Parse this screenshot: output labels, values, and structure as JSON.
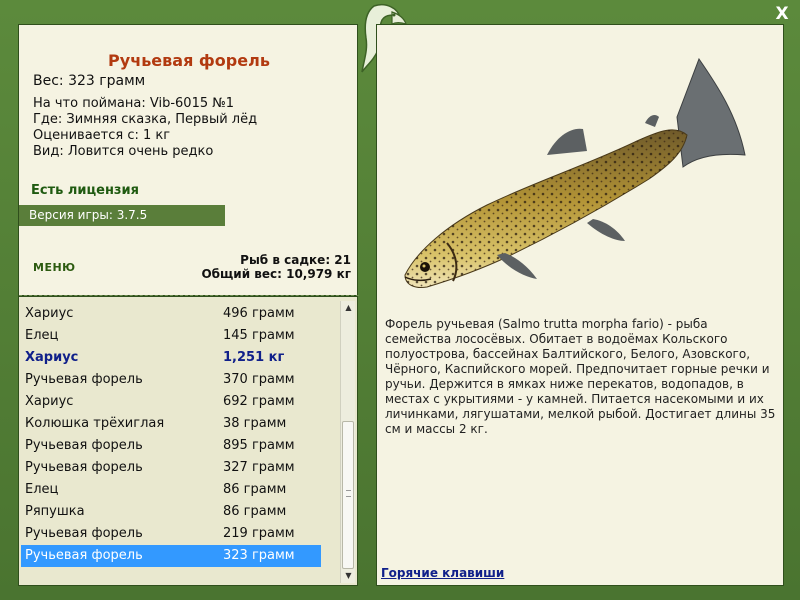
{
  "fish": {
    "title": "Ручьевая форель",
    "weight": "Вес: 323 грамм",
    "caught_with": "На что поймана: Vib-6015 №1",
    "location": "Где: Зимняя сказка, Первый лёд",
    "valued_from": "Оценивается с: 1 кг",
    "kind": "Вид: Ловится очень редко"
  },
  "license": "Есть лицензия",
  "version": "Версия игры: 3.7.5",
  "menu_label": "МЕНЮ",
  "stats": {
    "fish_in_keepnet": "Рыб в садке: 21",
    "total_weight": "Общий вес: 10,979 кг"
  },
  "catch_list": [
    {
      "name": "Хариус",
      "weight": "496 грамм",
      "style": "normal"
    },
    {
      "name": "Елец",
      "weight": "145 грамм",
      "style": "normal"
    },
    {
      "name": "Хариус",
      "weight": "1,251 кг",
      "style": "bold"
    },
    {
      "name": "Ручьевая форель",
      "weight": "370 грамм",
      "style": "normal"
    },
    {
      "name": "Хариус",
      "weight": "692 грамм",
      "style": "normal"
    },
    {
      "name": "Колюшка трёхиглая",
      "weight": "38 грамм",
      "style": "normal"
    },
    {
      "name": "Ручьевая форель",
      "weight": "895 грамм",
      "style": "normal"
    },
    {
      "name": "Ручьевая форель",
      "weight": "327 грамм",
      "style": "normal"
    },
    {
      "name": "Елец",
      "weight": "86 грамм",
      "style": "normal"
    },
    {
      "name": "Ряпушка",
      "weight": "86 грамм",
      "style": "normal"
    },
    {
      "name": "Ручьевая форель",
      "weight": "219 грамм",
      "style": "normal"
    },
    {
      "name": "Ручьевая форель",
      "weight": "323 грамм",
      "style": "selected"
    }
  ],
  "description": "Форель ручьевая (Salmo trutta morpha fario) - рыба семейства лососёвых. Обитает в водоёмах Кольского полуострова, бассейнах Балтийского, Белого, Азовского, Чёрного, Каспийского морей. Предпочитает горные речки и ручьи. Держится в ямках ниже перекатов, водопадов, в местах с укрытиями - у камней. Питается насекомыми и их личинками, лягушатами, мелкой рыбой. Достигает длины 35 см и массы 2 кг.",
  "hotkeys_link": "Горячие клавиши",
  "close_label": "X",
  "icons": {
    "close": "close-icon",
    "emblem": "fish-emblem-icon",
    "scroll_up": "scroll-up-icon",
    "scroll_down": "scroll-down-icon"
  },
  "colors": {
    "frame": "#4f7a33",
    "title": "#b23a10",
    "selection": "#3399ff",
    "highlight_text": "#10208a"
  }
}
